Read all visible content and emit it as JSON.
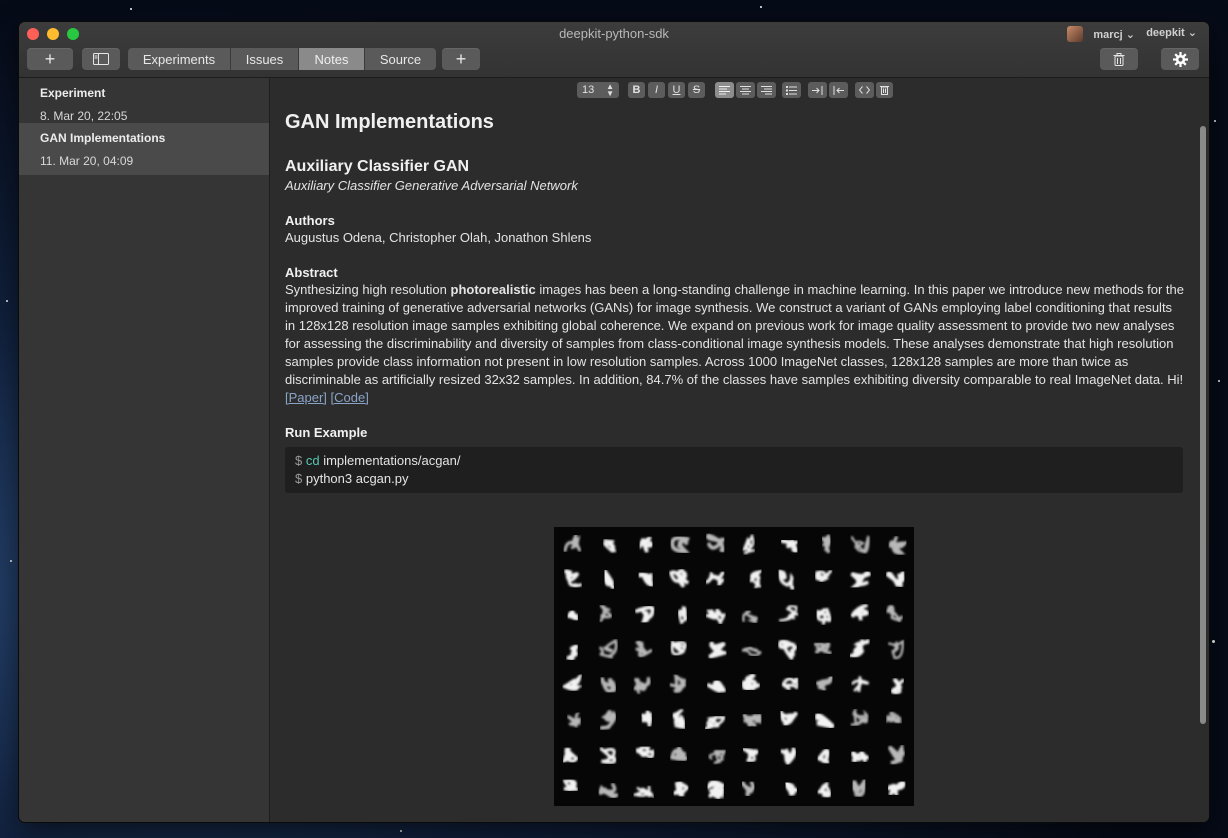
{
  "window": {
    "title": "deepkit-python-sdk"
  },
  "header": {
    "user": "marcj ⌄",
    "org": "deepkit ⌄",
    "add_label": "+",
    "tabs": [
      {
        "label": "Experiments",
        "active": false
      },
      {
        "label": "Issues",
        "active": false
      },
      {
        "label": "Notes",
        "active": true
      },
      {
        "label": "Source",
        "active": false
      }
    ],
    "add_tab_label": "+"
  },
  "sidebar": {
    "items": [
      {
        "title": "Experiment",
        "date": "8. Mar 20, 22:05",
        "selected": false
      },
      {
        "title": "GAN Implementations",
        "date": "11. Mar 20, 04:09",
        "selected": true
      }
    ]
  },
  "toolbar": {
    "font_size": "13",
    "bold": "B",
    "italic": "I",
    "underline": "U",
    "strike": "S"
  },
  "note": {
    "title": "GAN Implementations",
    "section_title": "Auxiliary Classifier GAN",
    "section_subtitle": "Auxiliary Classifier Generative Adversarial Network",
    "authors_heading": "Authors",
    "authors": "Augustus Odena, Christopher Olah, Jonathon Shlens",
    "abstract_heading": "Abstract",
    "abstract_pre": "Synthesizing high resolution ",
    "abstract_bold": "photorealistic",
    "abstract_post": " images has been a long-standing challenge in machine learning. In this paper we introduce new methods for the improved training of generative adversarial networks (GANs) for image synthesis. We construct a variant of GANs employing label conditioning that results in 128x128 resolution image samples exhibiting global coherence. We expand on previous work for image quality assessment to provide two new analyses for assessing the discriminability and diversity of samples from class-conditional image synthesis models. These analyses demonstrate that high resolution samples provide class information not present in low resolution samples. Across 1000 ImageNet classes, 128x128 samples are more than twice as discriminable as artificially resized 32x32 samples. In addition, 84.7% of the classes have samples exhibiting diversity comparable to real ImageNet data. Hi!",
    "paper_link": "[Paper]",
    "code_link": "[Code]",
    "run_heading": "Run Example",
    "code_lines": [
      {
        "prompt": "$",
        "cmd": "cd",
        "args": " implementations/acgan/"
      },
      {
        "prompt": "$",
        "cmd": "",
        "args": " python3 acgan.py"
      }
    ]
  },
  "colors": {
    "accent_link": "#8aa4c8",
    "code_keyword": "#56c8b0",
    "active_tab": "#8a8a8a"
  }
}
